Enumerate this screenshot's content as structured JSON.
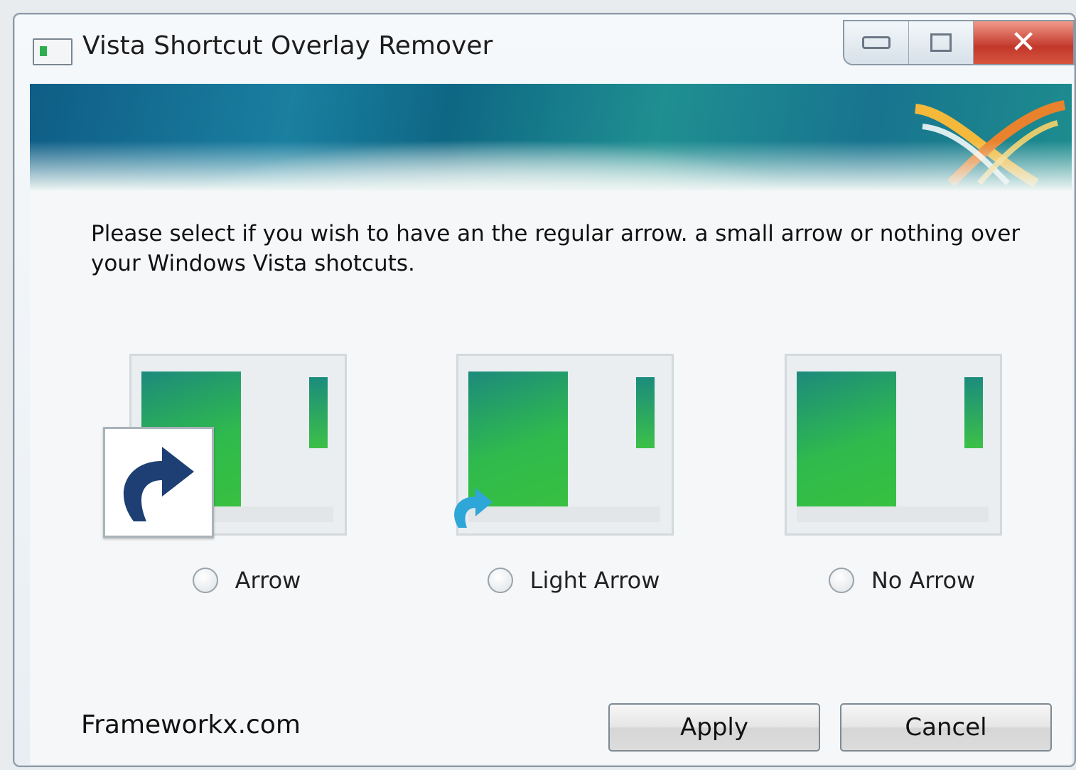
{
  "window": {
    "title": "Vista Shortcut Overlay Remover"
  },
  "instruction": "Please select if you wish to have an the regular arrow. a small arrow or nothing over your Windows Vista shotcuts.",
  "options": [
    {
      "label": "Arrow",
      "selected": false
    },
    {
      "label": "Light Arrow",
      "selected": false
    },
    {
      "label": "No Arrow",
      "selected": false
    }
  ],
  "footer": {
    "brand": "Frameworkx.com",
    "apply_label": "Apply",
    "cancel_label": "Cancel"
  },
  "colors": {
    "accent": "#1a7fa0",
    "close": "#c2372a",
    "screen_green": "#2fba4d"
  }
}
